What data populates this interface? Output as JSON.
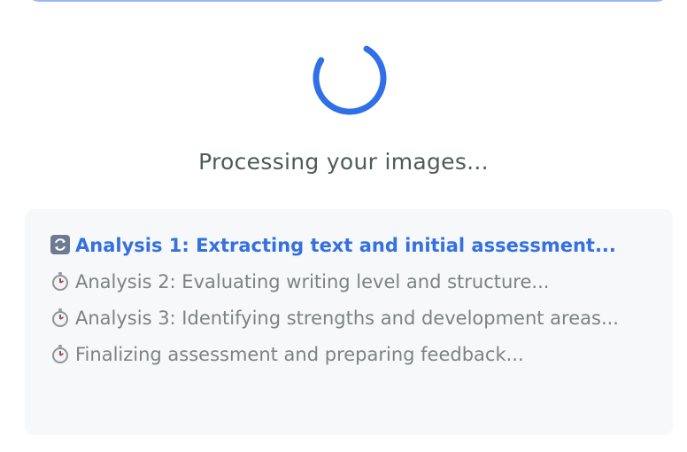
{
  "status": {
    "message": "Processing your images..."
  },
  "spinner": {
    "icon": "loading-spinner-icon",
    "color": "#2f6fe8"
  },
  "steps": [
    {
      "icon": "refresh-icon",
      "state": "active",
      "label": "Analysis 1: Extracting text and initial assessment..."
    },
    {
      "icon": "stopwatch-icon",
      "state": "pending",
      "label": "Analysis 2: Evaluating writing level and structure..."
    },
    {
      "icon": "stopwatch-icon",
      "state": "pending",
      "label": "Analysis 3: Identifying strengths and development areas..."
    },
    {
      "icon": "stopwatch-icon",
      "state": "pending",
      "label": "Finalizing assessment and preparing feedback..."
    }
  ],
  "colors": {
    "active_step": "#3470df",
    "pending_step": "#7c8380",
    "title": "#4f5b57",
    "card_bg": "#f6f8fa"
  }
}
